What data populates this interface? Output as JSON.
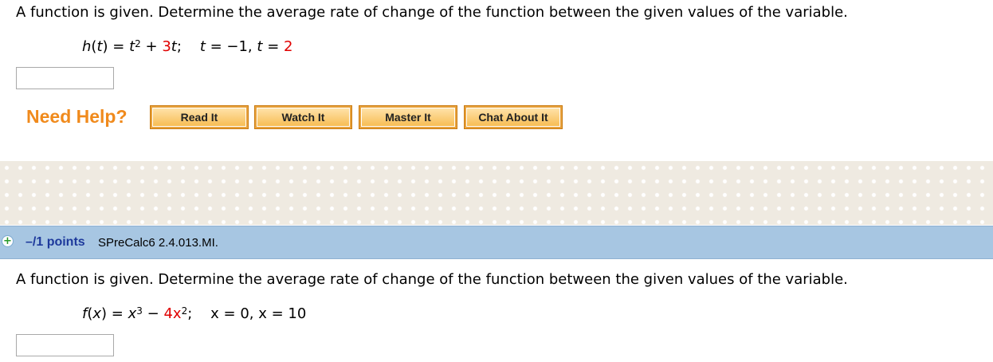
{
  "question1": {
    "prompt": "A function is given. Determine the average rate of change of the function between the given values of the variable.",
    "formula": {
      "fn_name": "h",
      "var": "t",
      "term1_base": "t",
      "term1_exp": "2",
      "plus": "+",
      "term2_coef": "3",
      "term2_var": "t",
      "values_a": "t = −1,",
      "values_b_var": "t",
      "values_b_eq": "=",
      "values_b_val": "2"
    },
    "answer_value": ""
  },
  "help": {
    "label": "Need Help?",
    "buttons": [
      "Read It",
      "Watch It",
      "Master It",
      "Chat About It"
    ]
  },
  "question2": {
    "points": "–/1 points",
    "reference": "SPreCalc6 2.4.013.MI.",
    "prompt": "A function is given. Determine the average rate of change of the function between the given values of the variable.",
    "formula": {
      "fn_name": "f",
      "var": "x",
      "term1_base": "x",
      "term1_exp": "3",
      "minus": "−",
      "term2_coef": "4x",
      "term2_exp": "2",
      "values": "x = 0, x = 10"
    },
    "answer_value": ""
  },
  "colors": {
    "help_orange": "#f08a1c",
    "question_bar": "#a7c6e2",
    "points_blue": "#1e3a9c",
    "highlight_red": "#e00000"
  }
}
